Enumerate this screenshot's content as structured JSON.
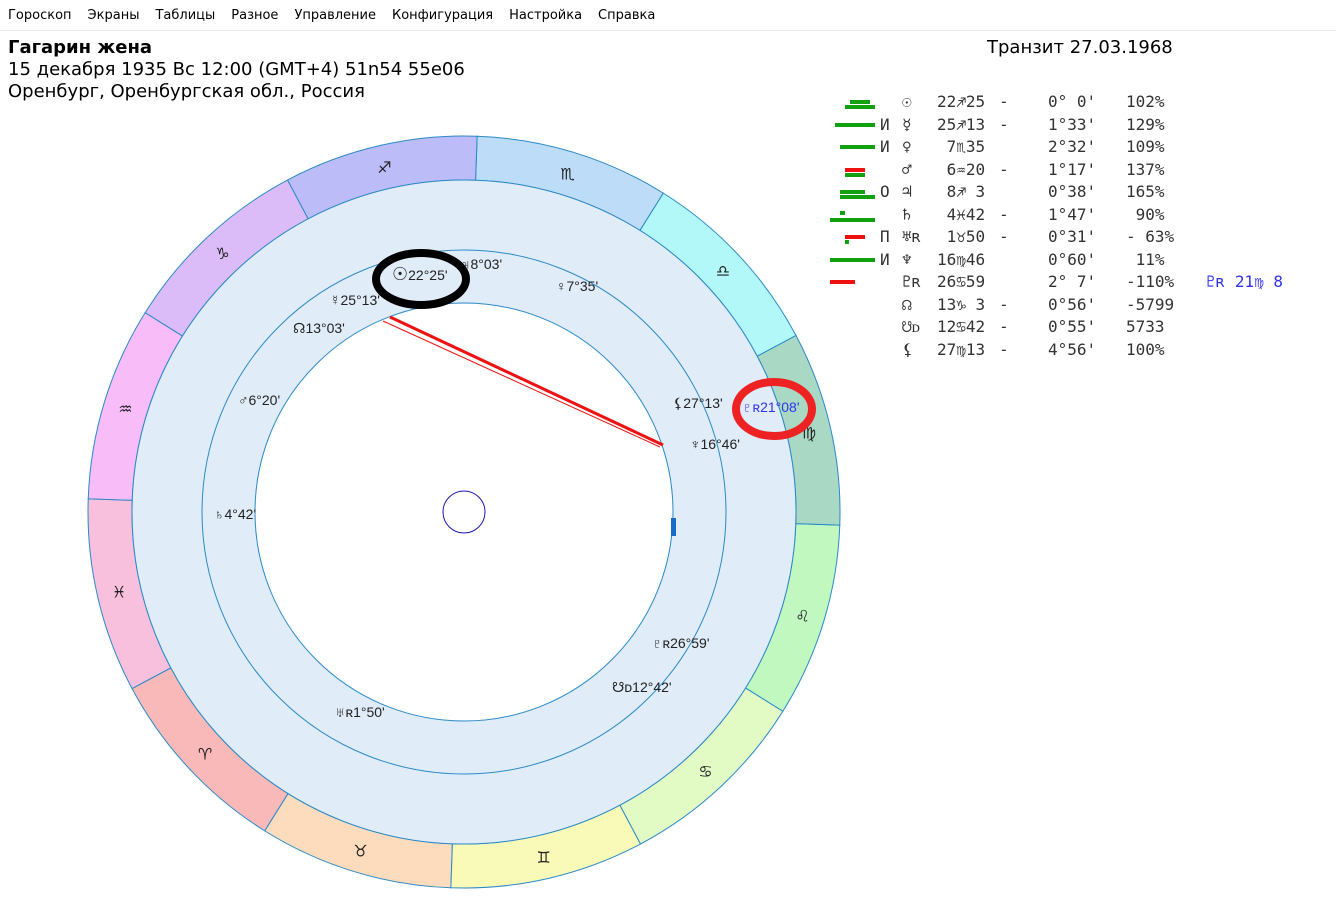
{
  "menu": [
    "Гороскоп",
    "Экраны",
    "Таблицы",
    "Разное",
    "Управление",
    "Конфигурация",
    "Настройка",
    "Справка"
  ],
  "header": {
    "name": "Гагарин жена",
    "date_line": "15 декабря 1935  Вс  12:00 (GMT+4) 51n54  55e06",
    "place": "Оренбург, Оренбургская обл., Россия",
    "transit": "Транзит 27.03.1968"
  },
  "zodiac": [
    {
      "sign": "♈",
      "color": "#f9b9b9"
    },
    {
      "sign": "♉",
      "color": "#fcdcbc"
    },
    {
      "sign": "♊",
      "color": "#fafab8"
    },
    {
      "sign": "♋",
      "color": "#e2fac4"
    },
    {
      "sign": "♌",
      "color": "#c0f8c0"
    },
    {
      "sign": "♍",
      "color": "#a9d9c4"
    },
    {
      "sign": "♎",
      "color": "#b2f8f8"
    },
    {
      "sign": "♏",
      "color": "#bcdcf8"
    },
    {
      "sign": "♐",
      "color": "#bcbcf8"
    },
    {
      "sign": "♑",
      "color": "#dcbcf8"
    },
    {
      "sign": "♒",
      "color": "#f8bcf8"
    },
    {
      "sign": "♓",
      "color": "#f8c0dc"
    }
  ],
  "chart_labels": [
    {
      "glyph": "☉",
      "text": "22°25'"
    },
    {
      "glyph": "♃",
      "text": "8°03'"
    },
    {
      "glyph": "♀",
      "text": "7°35'"
    },
    {
      "glyph": "☿",
      "text": "25°13'"
    },
    {
      "glyph": "☊",
      "text": "13°03'"
    },
    {
      "glyph": "♂",
      "text": "6°20'"
    },
    {
      "glyph": "♄",
      "text": "4°42'"
    },
    {
      "glyph": "⚸",
      "text": "27°13'"
    },
    {
      "glyph": "♆",
      "text": "16°46'"
    },
    {
      "glyph": "♇ʀ",
      "text": "26°59'"
    },
    {
      "glyph": "☋ᴅ",
      "text": "12°42'"
    },
    {
      "glyph": "♅ʀ",
      "text": "1°50'"
    },
    {
      "glyph": "♇ʀ",
      "text": "21°08'"
    }
  ],
  "table": [
    {
      "mark": "",
      "glyph": "☉",
      "pos": "22♐25",
      "dash": "-",
      "orb": "0° 0'",
      "pct": "102%"
    },
    {
      "mark": "И",
      "glyph": "☿",
      "pos": "25♐13",
      "dash": "-",
      "orb": "1°33'",
      "pct": "129%"
    },
    {
      "mark": "И",
      "glyph": "♀",
      "pos": " 7♏35",
      "dash": " ",
      "orb": "2°32'",
      "pct": "109%"
    },
    {
      "mark": "",
      "glyph": "♂",
      "pos": " 6♒20",
      "dash": "-",
      "orb": "1°17'",
      "pct": "137%"
    },
    {
      "mark": "О",
      "glyph": "♃",
      "pos": " 8♐ 3",
      "dash": " ",
      "orb": "0°38'",
      "pct": "165%"
    },
    {
      "mark": "",
      "glyph": "♄",
      "pos": " 4♓42",
      "dash": "-",
      "orb": "1°47'",
      "pct": " 90%"
    },
    {
      "mark": "П",
      "glyph": "♅ʀ",
      "pos": " 1♉50",
      "dash": "-",
      "orb": "0°31'",
      "pct": "- 63%"
    },
    {
      "mark": "И",
      "glyph": "♆",
      "pos": "16♍46",
      "dash": " ",
      "orb": "0°60'",
      "pct": " 11%"
    },
    {
      "mark": "",
      "glyph": "♇ʀ",
      "pos": "26♋59",
      "dash": " ",
      "orb": "2° 7'",
      "pct": "-110%"
    },
    {
      "mark": "",
      "glyph": "☊",
      "pos": "13♑ 3",
      "dash": "-",
      "orb": "0°56'",
      "pct": "-5799"
    },
    {
      "mark": "",
      "glyph": "☋ᴅ",
      "pos": "12♋42",
      "dash": "-",
      "orb": "0°55'",
      "pct": "5733"
    },
    {
      "mark": "",
      "glyph": "⚸",
      "pos": "27♍13",
      "dash": "-",
      "orb": "4°56'",
      "pct": "100%"
    }
  ],
  "transit_extra": "♇ʀ 21♍ 8",
  "colors": {
    "ring_line": "#2a8ac8",
    "ring_fill": "#e0ecf8",
    "aspect": "#ee1111",
    "green": "#10a010",
    "red": "#ee1111",
    "transit_text": "#3333ee"
  }
}
